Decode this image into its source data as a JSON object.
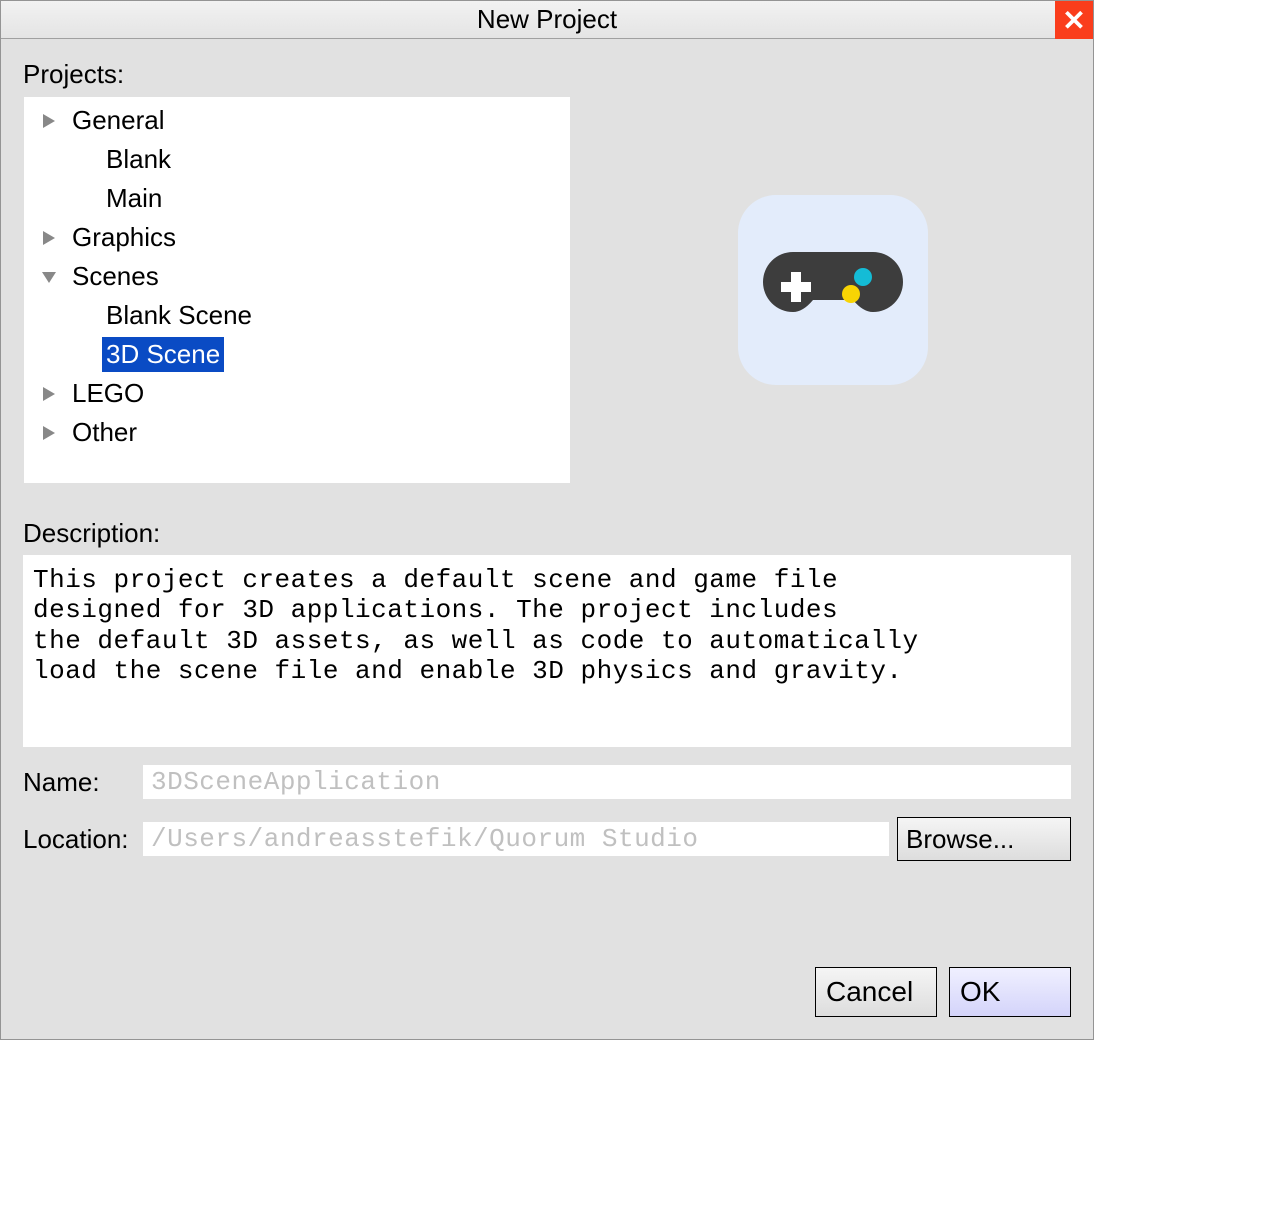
{
  "window": {
    "title": "New Project"
  },
  "labels": {
    "projects": "Projects:",
    "description": "Description:",
    "name": "Name:",
    "location": "Location:"
  },
  "tree": {
    "general": {
      "label": "General",
      "expanded": true
    },
    "blank": {
      "label": "Blank"
    },
    "main": {
      "label": "Main"
    },
    "graphics": {
      "label": "Graphics",
      "expanded": false
    },
    "scenes": {
      "label": "Scenes",
      "expanded": true
    },
    "blank_scene": {
      "label": "Blank Scene"
    },
    "scene_3d": {
      "label": "3D Scene",
      "selected": true
    },
    "lego": {
      "label": "LEGO",
      "expanded": false
    },
    "other": {
      "label": "Other",
      "expanded": false
    }
  },
  "description_text": "This project creates a default scene and game file\ndesigned for 3D applications. The project includes\nthe default 3D assets, as well as code to automatically\nload the scene file and enable 3D physics and gravity.",
  "form": {
    "name_value": "3DSceneApplication",
    "location_value": "/Users/andreasstefik/Quorum Studio"
  },
  "buttons": {
    "browse": "Browse...",
    "cancel": "Cancel",
    "ok": "OK"
  }
}
